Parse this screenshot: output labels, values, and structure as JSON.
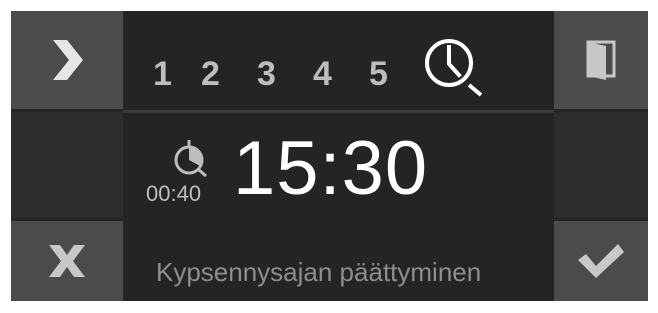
{
  "program_slots": [
    "1",
    "2",
    "3",
    "4",
    "5"
  ],
  "clock_mode_icon": "clock-end-time-icon",
  "timer": {
    "icon": "timer-icon",
    "duration": "00:40"
  },
  "end_time": "15:30",
  "caption": "Kypsennysajan päättyminen",
  "buttons": {
    "next": "chevron-right-icon",
    "door": "door-icon",
    "cancel": "x-icon",
    "confirm": "checkmark-icon"
  },
  "colors": {
    "panel": "#252525",
    "side_button": "#4b4b4b",
    "digit_text": "#bdbdbd",
    "main_text": "#ffffff",
    "caption_text": "#8e8e8e"
  }
}
